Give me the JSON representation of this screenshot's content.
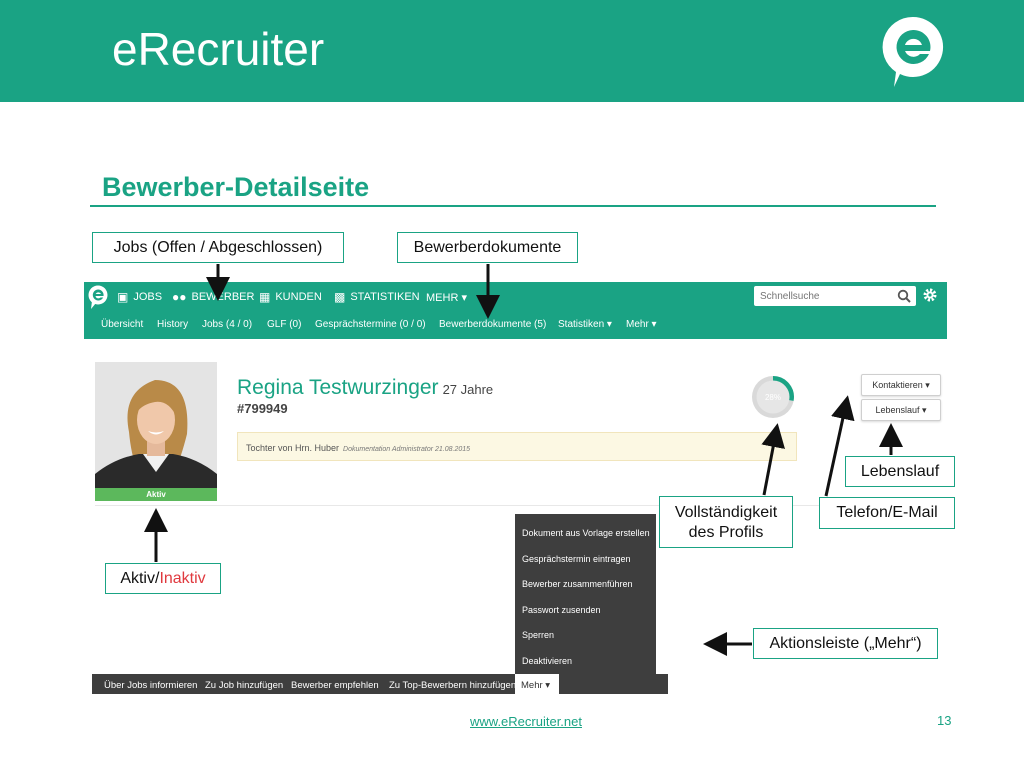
{
  "slide": {
    "app_title": "eRecruiter",
    "heading": "Bewerber-Detailseite",
    "footer_link": "www.eRecruiter.net",
    "page_number": "13"
  },
  "callouts": {
    "jobs": "Jobs (Offen / Abgeschlossen)",
    "documents": "Bewerberdokumente",
    "completeness_line1": "Vollständigkeit",
    "completeness_line2": "des Profils",
    "contact": "Telefon/E-Mail",
    "cv": "Lebenslauf",
    "active_part": "Aktiv/",
    "inactive_part": "Inaktiv",
    "action_bar": "Aktionsleiste („Mehr“)"
  },
  "app": {
    "top_nav": {
      "jobs": "JOBS",
      "applicants": "BEWERBER",
      "customers": "KUNDEN",
      "statistics": "STATISTIKEN",
      "more": "MEHR ▾",
      "search_placeholder": "Schnellsuche"
    },
    "sub_nav": {
      "overview": "Übersicht",
      "history": "History",
      "jobs": "Jobs (4 / 0)",
      "glf": "GLF (0)",
      "appointments": "Gesprächstermine (0 / 0)",
      "documents": "Bewerberdokumente (5)",
      "statistics": "Statistiken ▾",
      "more": "Mehr ▾"
    },
    "profile": {
      "name": "Regina Testwurzinger",
      "age": "27 Jahre",
      "id": "#799949",
      "status": "Aktiv",
      "note": "Tochter von Hrn. Huber",
      "note_meta": "Dokumentation Administrator  21.08.2015",
      "completeness_label": "28%",
      "completeness_value": 0.28,
      "contact_button": "Kontaktieren ▾",
      "cv_button": "Lebenslauf ▾"
    },
    "more_menu": [
      "Dokument aus Vorlage erstellen",
      "Gesprächstermin eintragen",
      "Bewerber zusammenführen",
      "Passwort zusenden",
      "Sperren",
      "Deaktivieren"
    ],
    "action_bar": [
      "Über Jobs informieren",
      "Zu Job hinzufügen",
      "Bewerber empfehlen",
      "Zu Top-Bewerbern hinzufügen"
    ],
    "action_more": "Mehr ▾"
  },
  "colors": {
    "brand": "#1aa384",
    "active": "#5cb85c",
    "inactive": "#e0393e",
    "dark_menu": "#3e3e3e"
  }
}
